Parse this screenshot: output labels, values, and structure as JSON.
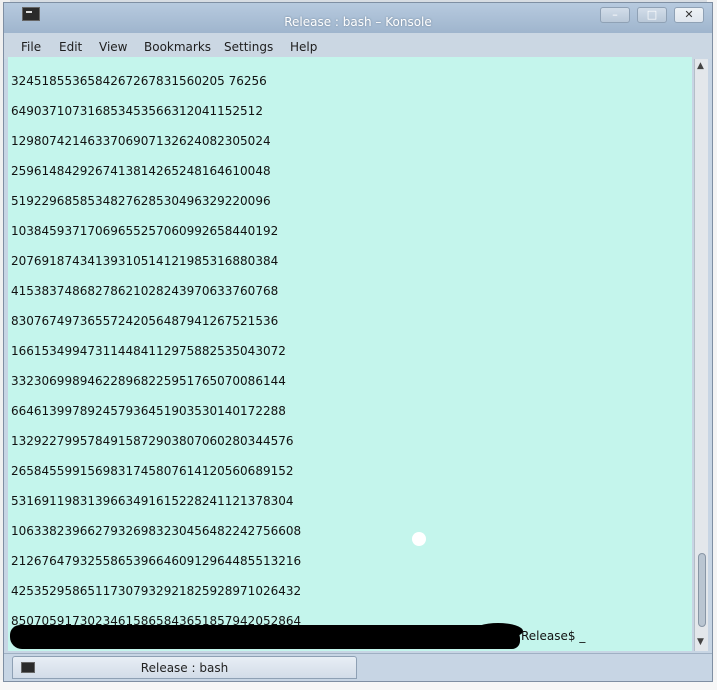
{
  "window": {
    "title": "Release : bash – Konsole",
    "app_icon": "terminal-icon",
    "controls": {
      "minimize": "–",
      "maximize": "□",
      "close": "✕"
    }
  },
  "menu": {
    "items": [
      "File",
      "Edit",
      "View",
      "Bookmarks",
      "Settings",
      "Help"
    ]
  },
  "terminal": {
    "background": "#c4f5ec",
    "lines": [
      "3245185536584267267831560205 76256",
      "649037107316853453566312041152512",
      "1298074214633706907132624082305024",
      "2596148429267413814265248164610048",
      "5192296858534827628530496329220096",
      "10384593717069655257060992658440192",
      "20769187434139310514121985316880384",
      "41538374868278621028243970633760768",
      "83076749736557242056487941267521536",
      "166153499473114484112975882535043072",
      "332306998946228968225951765070086144",
      "664613997892457936451903530140172288",
      "1329227995784915872903807060280344576",
      "2658455991569831745807614120560689152",
      "5316911983139663491615228241121378304",
      "10633823966279326983230456482242756608",
      "21267647932558653966460912964485513216",
      "42535295865117307932921825928971026432",
      "85070591730234615865843651857942052864"
    ],
    "prompt": "Release$ _"
  },
  "tabbar": {
    "tab_label": "Release : bash"
  }
}
